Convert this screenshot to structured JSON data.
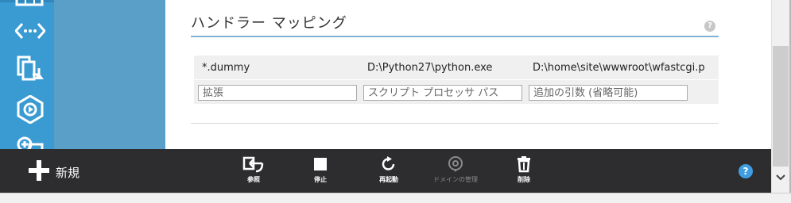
{
  "section": {
    "title": "ハンドラー マッピング",
    "help_glyph": "?"
  },
  "table": {
    "row": {
      "extension": "*.dummy",
      "processor_path": "D:\\Python27\\python.exe",
      "arguments": "D:\\home\\site\\wwwroot\\wfastcgi.p"
    },
    "new_row": {
      "extension_placeholder": "拡張",
      "processor_placeholder": "スクリプト プロセッサ パス",
      "arguments_placeholder": "追加の引数 (省略可能)"
    }
  },
  "commandbar": {
    "new_label": "新規",
    "browse_label": "参照",
    "stop_label": "停止",
    "restart_label": "再起動",
    "domains_label": "ドメインの管理",
    "delete_label": "削除",
    "help_glyph": "?"
  },
  "nav": {
    "icons": [
      "table-icon",
      "code-icon",
      "deploy-icon",
      "monitor-icon",
      "add-tag-icon"
    ]
  },
  "colors": {
    "nav": "#3a9bd3",
    "panel": "#5a9fc7",
    "commandbar": "#2d2d30",
    "accent": "#3f9de0"
  }
}
